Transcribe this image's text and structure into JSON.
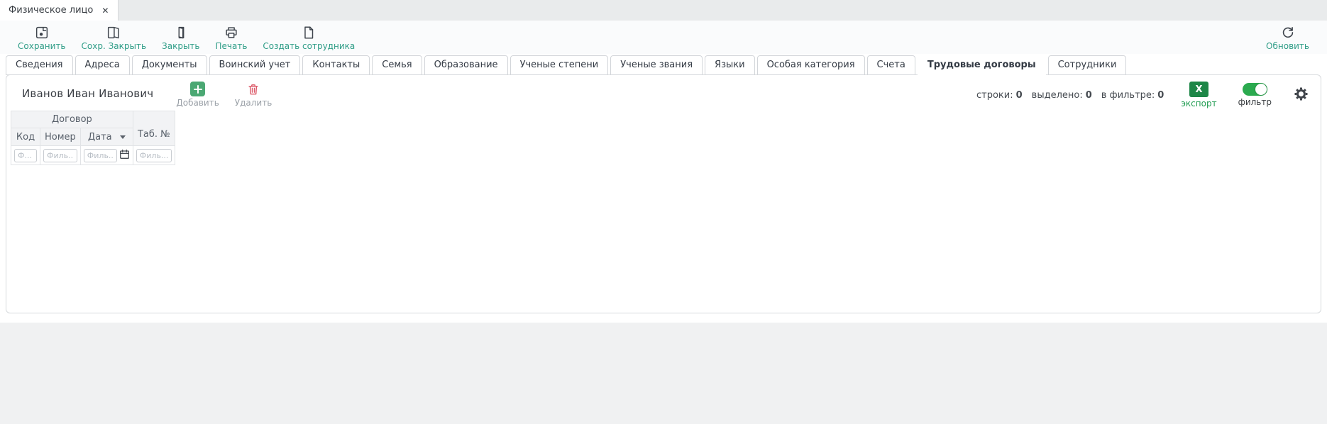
{
  "titlebar": {
    "doc_tab_label": "Физическое лицо",
    "close_glyph": "✕"
  },
  "toolbar": {
    "save": "Сохранить",
    "save_close": "Сохр. Закрыть",
    "close": "Закрыть",
    "print": "Печать",
    "create_employee": "Создать сотрудника",
    "refresh": "Обновить"
  },
  "tabs": [
    "Сведения",
    "Адреса",
    "Документы",
    "Воинский учет",
    "Контакты",
    "Семья",
    "Образование",
    "Ученые степени",
    "Ученые звания",
    "Языки",
    "Особая категория",
    "Счета",
    "Трудовые договоры",
    "Сотрудники"
  ],
  "active_tab": "Трудовые договоры",
  "content": {
    "person_name": "Иванов Иван Иванович",
    "add_label": "Добавить",
    "delete_label": "Удалить",
    "stats": {
      "rows_label": "строки:",
      "rows_value": "0",
      "selected_label": "выделено:",
      "selected_value": "0",
      "in_filter_label": "в фильтре:",
      "in_filter_value": "0"
    },
    "export_glyph": "X",
    "export_label": "экспорт",
    "filter_label": "фильтр",
    "filter_toggle_state": "on"
  },
  "table": {
    "group_header": "Договор",
    "columns": [
      {
        "label": "Код",
        "placeholder": "Ф..."
      },
      {
        "label": "Номер",
        "placeholder": "Филь..."
      },
      {
        "label": "Дата",
        "placeholder": "Филь...",
        "sorted": "desc"
      },
      {
        "label": "Таб. №",
        "placeholder": "Филь..."
      }
    ]
  },
  "colors": {
    "toolbar_label_teal": "#2f9d87",
    "add_green": "#4ba873",
    "delete_red": "#dc5a69",
    "export_green": "#1d8647",
    "export_label_green": "#1f9b50",
    "toggle_green": "#2baa4f",
    "header_bg": "#f2f3f5",
    "strip_bg": "#e9ebec"
  }
}
